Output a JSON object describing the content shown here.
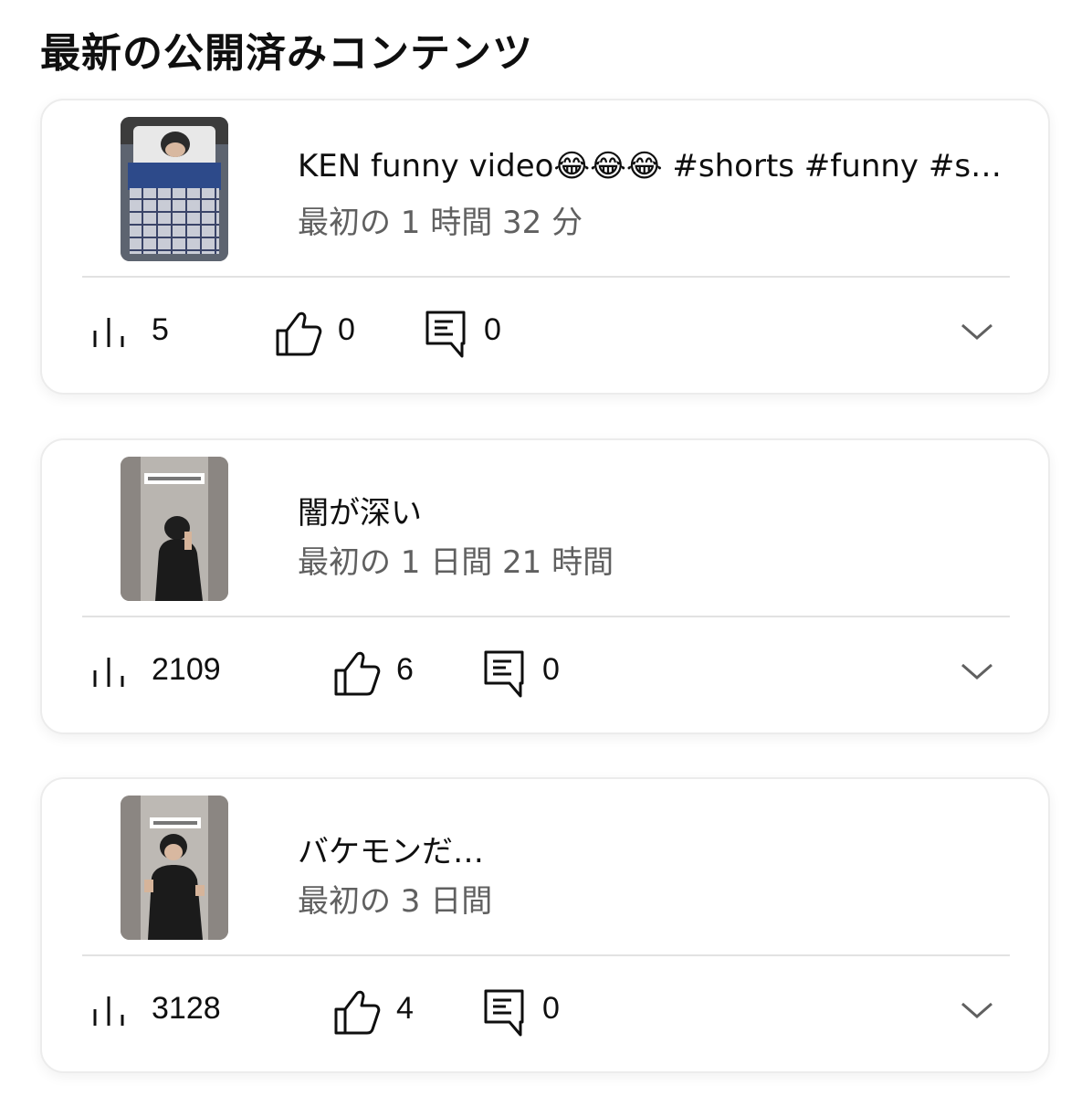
{
  "page": {
    "title": "最新の公開済みコンテンツ"
  },
  "icons": {
    "views": "bar-chart-icon",
    "likes": "thumbs-up-icon",
    "comments": "comment-icon",
    "expand": "chevron-down-icon"
  },
  "colors": {
    "primary_text": "#0f0f0f",
    "secondary_text": "#606060",
    "divider": "#e2e2e2",
    "card_border": "#ececec"
  },
  "videos": [
    {
      "title": "KEN funny video😂😂😂 #shorts #funny #sh...",
      "subtitle": "最初の 1 時間 32 分",
      "views": "5",
      "likes": "0",
      "comments": "0"
    },
    {
      "title": "闇が深い",
      "subtitle": "最初の 1 日間 21 時間",
      "views": "2109",
      "likes": "6",
      "comments": "0"
    },
    {
      "title": "バケモンだ…",
      "subtitle": "最初の 3 日間",
      "views": "3128",
      "likes": "4",
      "comments": "0"
    }
  ]
}
